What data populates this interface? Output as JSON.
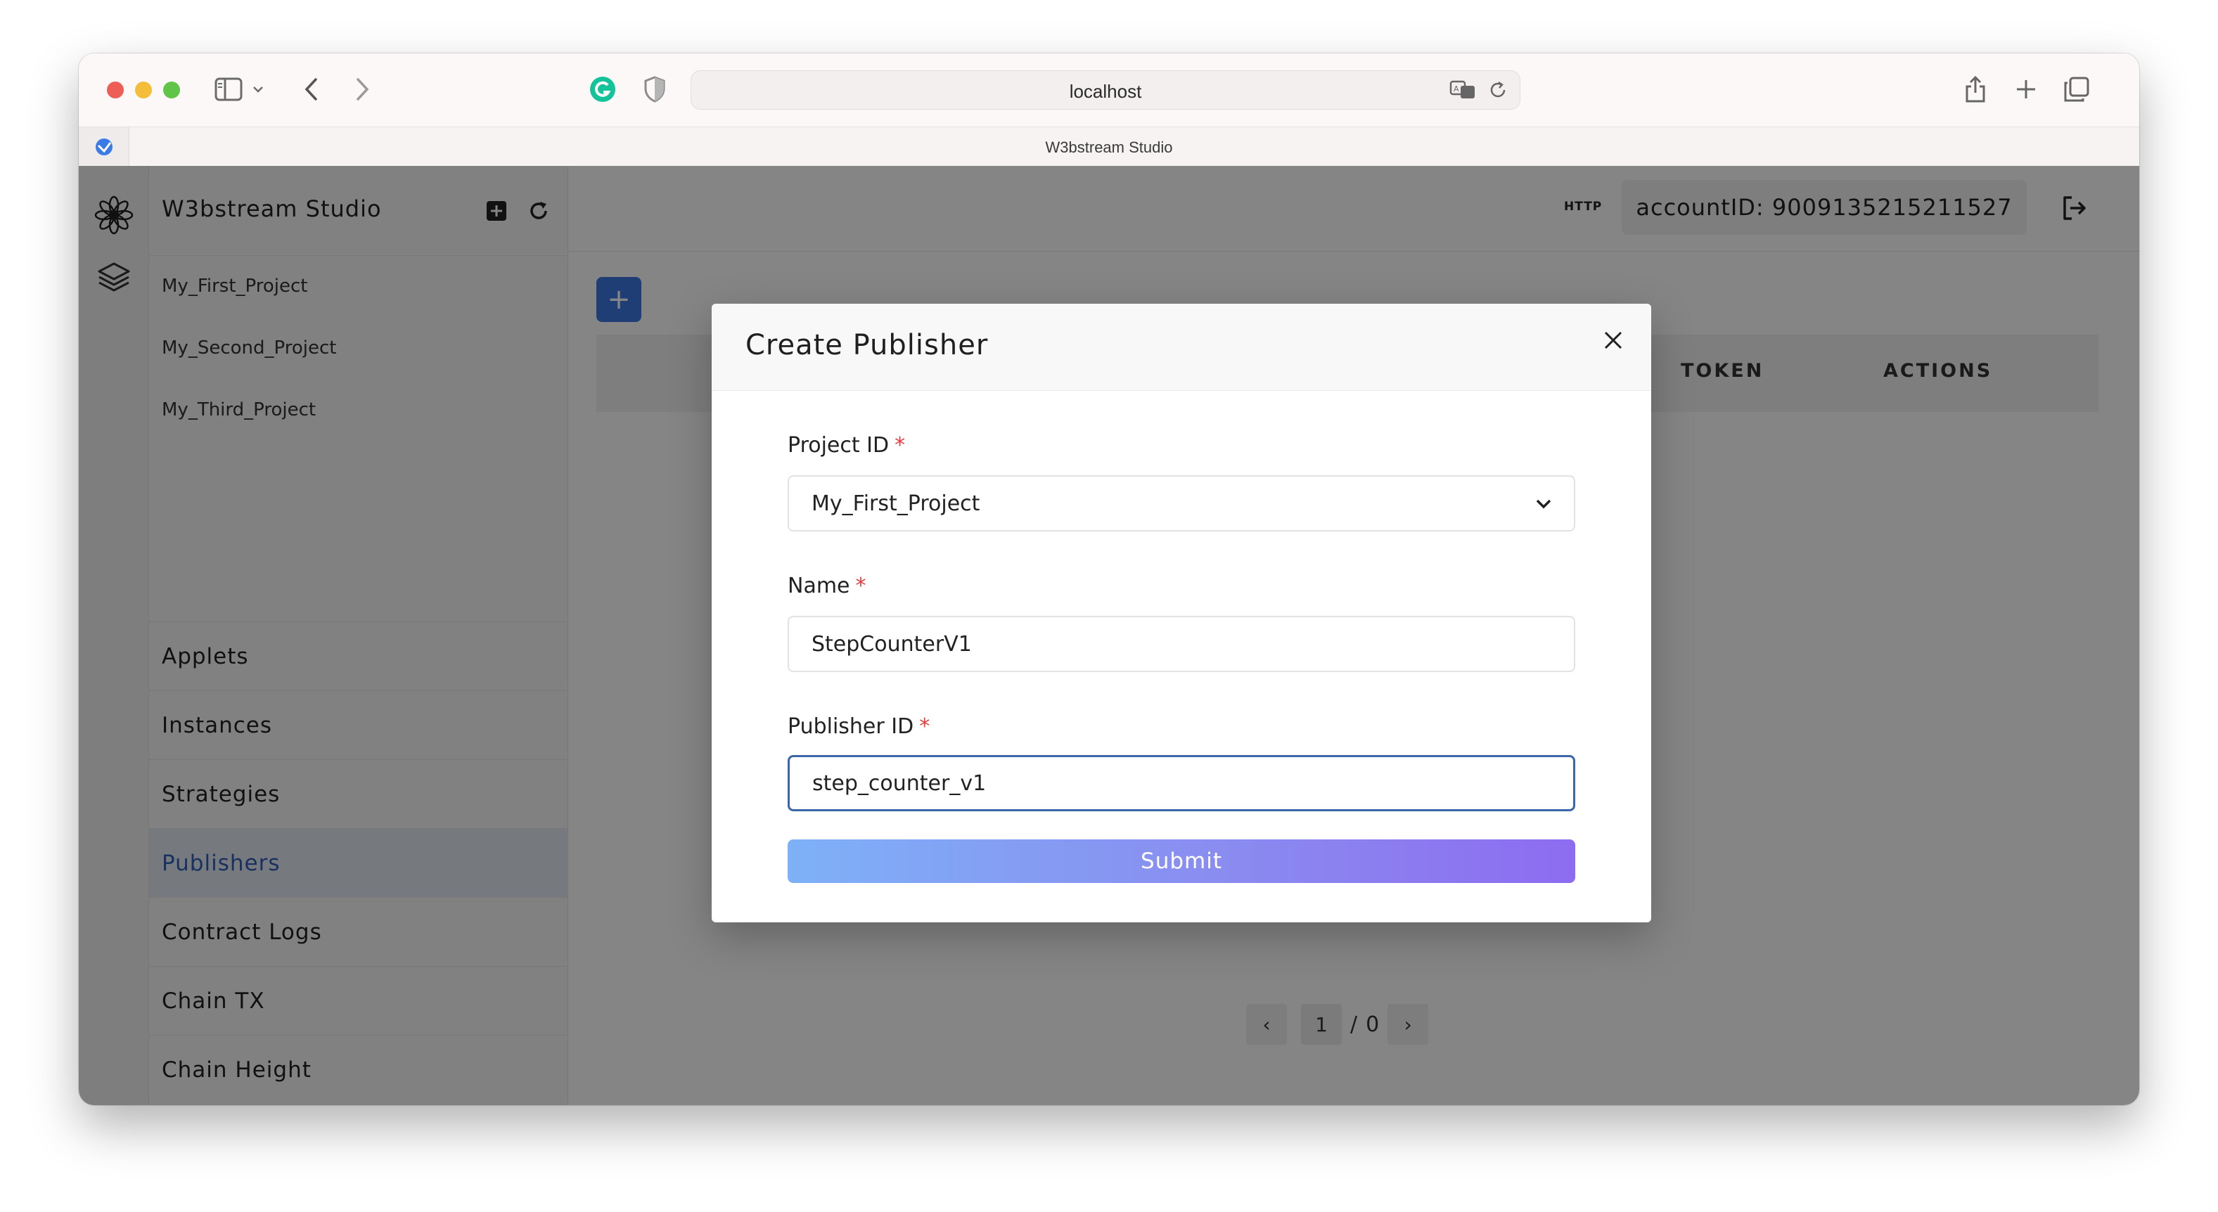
{
  "browser": {
    "url": "localhost",
    "tab_title": "W3bstream Studio"
  },
  "sidebar": {
    "title": "W3bstream Studio",
    "projects": [
      "My_First_Project",
      "My_Second_Project",
      "My_Third_Project"
    ],
    "menu": [
      "Applets",
      "Instances",
      "Strategies",
      "Publishers",
      "Contract Logs",
      "Chain TX",
      "Chain Height"
    ],
    "active_menu": "Publishers"
  },
  "header": {
    "protocol_badge": "HTTP",
    "account": "accountID: 9009135215211527"
  },
  "table": {
    "columns": [
      "TOKEN",
      "ACTIONS"
    ]
  },
  "pagination": {
    "current": "1",
    "separator": "/",
    "total": "0"
  },
  "modal": {
    "title": "Create Publisher",
    "required_mark": "*",
    "project_id": {
      "label": "Project ID",
      "value": "My_First_Project"
    },
    "name": {
      "label": "Name",
      "value": "StepCounterV1"
    },
    "publisher_id": {
      "label": "Publisher ID",
      "value": "step_counter_v1"
    },
    "submit_label": "Submit"
  },
  "colors": {
    "accent": "#3a78e0",
    "active_menu_text": "#2f5fb8",
    "required": "#e53e3e",
    "focus_border": "#3b67a8"
  }
}
